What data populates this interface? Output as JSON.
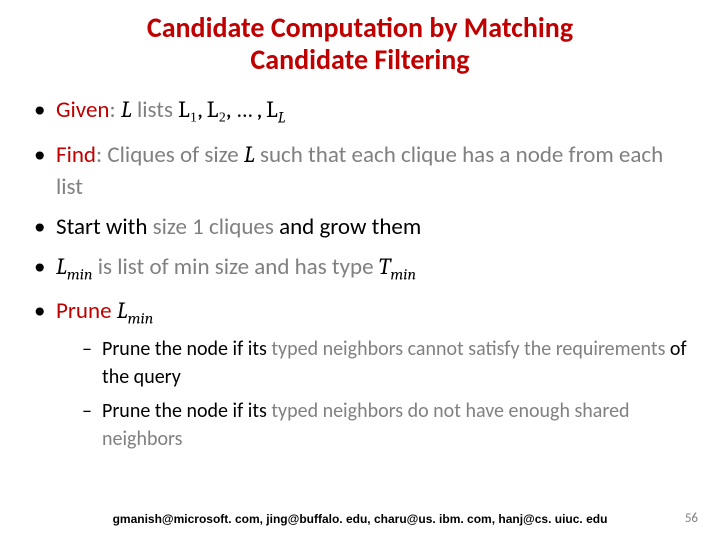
{
  "title_line1": "Candidate Computation by Matching",
  "title_line2": "Candidate Filtering",
  "b1": {
    "given": "Given",
    "colon": ": ",
    "L": "L",
    "lists": " lists ",
    "seq": "L₁, L₂, … , L",
    "seq_sub": "L"
  },
  "b2": {
    "find": "Find",
    "rest1": ": Cliques of size ",
    "L": "L",
    "rest2": " such that each clique has a node from each list"
  },
  "b3": {
    "pre": "Start with ",
    "mid": "size 1 cliques",
    "post": " and grow them"
  },
  "b4": {
    "Lmin_L": "L",
    "Lmin_sub": "min",
    "mid": " is list of min size and has type ",
    "Tmin_T": "T",
    "Tmin_sub": "min"
  },
  "b5": {
    "prune": "Prune ",
    "Lmin_L": "L",
    "Lmin_sub": "min"
  },
  "s1": {
    "pre": "Prune the node if its ",
    "mid": "typed neighbors cannot satisfy the requirements",
    "post": " of the query"
  },
  "s2": {
    "pre": "Prune the node if its ",
    "mid": "typed neighbors do not have enough shared neighbors",
    "post": ""
  },
  "footer": "gmanish@microsoft. com, jing@buffalo. edu, charu@us. ibm. com, hanj@cs. uiuc. edu",
  "page": "56"
}
